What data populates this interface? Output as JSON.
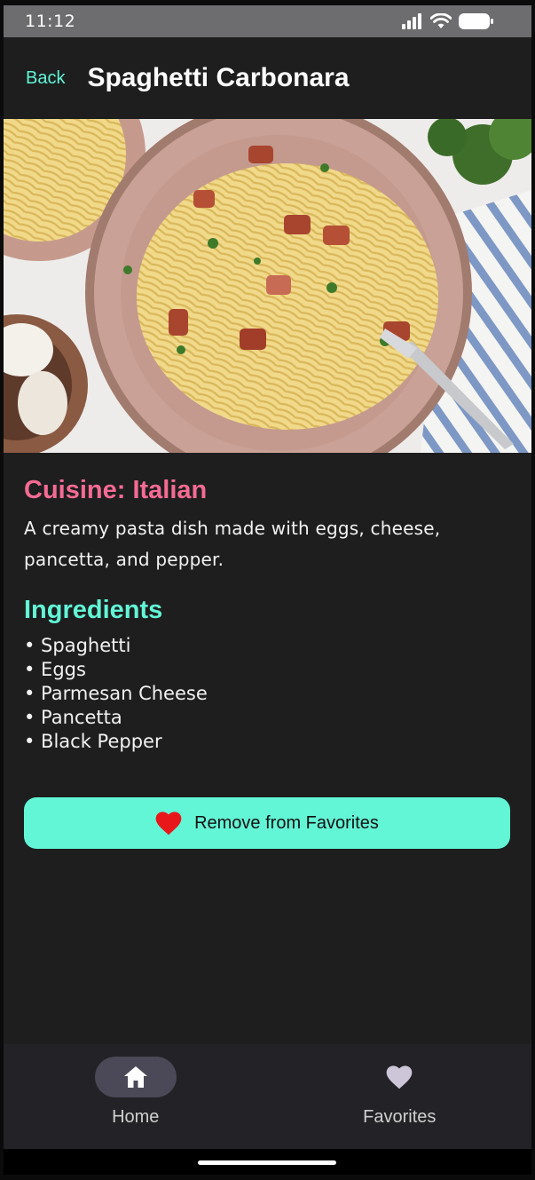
{
  "status_bar": {
    "time": "11:12"
  },
  "header": {
    "back_label": "Back",
    "title": "Spaghetti Carbonara"
  },
  "recipe": {
    "cuisine": "Cuisine: Italian",
    "description": "A creamy pasta dish made with eggs, cheese, pancetta, and pepper.",
    "ingredients_heading": "Ingredients",
    "ingredients": [
      "• Spaghetti",
      "• Eggs",
      "• Parmesan Cheese",
      "• Pancetta",
      "• Black Pepper"
    ]
  },
  "favorite_button": {
    "label": "Remove from Favorites",
    "icon": "heart-icon"
  },
  "bottom_nav": {
    "items": [
      {
        "label": "Home",
        "icon": "home-icon",
        "active": true
      },
      {
        "label": "Favorites",
        "icon": "heart-icon",
        "active": false
      }
    ]
  },
  "colors": {
    "accent": "#62f5d6",
    "cuisine_pink": "#f46b93",
    "heart_red": "#e8181a",
    "background": "#1e1e1f"
  }
}
